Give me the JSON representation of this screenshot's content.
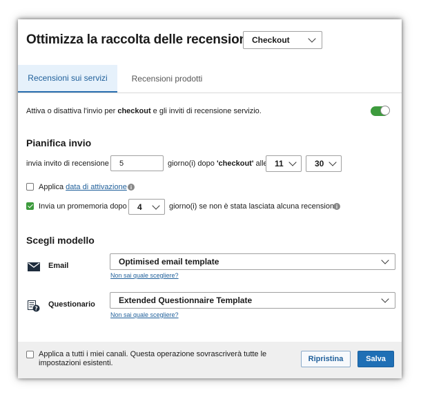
{
  "header": {
    "title": "Ottimizza la raccolta delle recensioni per",
    "channel_select": "Checkout"
  },
  "tabs": [
    {
      "label": "Recensioni sui servizi",
      "active": true
    },
    {
      "label": "Recensioni prodotti",
      "active": false
    }
  ],
  "toggle_row": {
    "pre": "Attiva o disattiva l'invio per ",
    "bold": "checkout",
    "post": " e gli inviti di recensione servizio.",
    "enabled": true
  },
  "schedule": {
    "title": "Pianifica invio",
    "send_label": "invia invito di recensione",
    "days_value": "5",
    "after_pre": "giorno(i) dopo ",
    "after_bold": "'checkout'",
    "after_post": " alle",
    "hour": "11",
    "minute": "30",
    "apply_label_pre": "Applica ",
    "apply_link": "data di attivazione",
    "apply_checked": false,
    "reminder_label": "Invia un promemoria dopo",
    "reminder_checked": true,
    "reminder_days": "4",
    "reminder_suffix": "giorno(i) se non è stata lasciata alcuna recensione"
  },
  "templates": {
    "title": "Scegli modello",
    "email": {
      "label": "Email",
      "value": "Optimised email template",
      "help": "Non sai quale scegliere?"
    },
    "questionnaire": {
      "label": "Questionario",
      "value": "Extended Questionnaire Template",
      "help": "Non sai quale scegliere?"
    }
  },
  "footer": {
    "apply_all_line1": "Applica a tutti i miei canali. Questa operazione sovrascriverà tutte le",
    "apply_all_line2": "impostazioni esistenti.",
    "apply_all_checked": false,
    "reset_label": "Ripristina",
    "save_label": "Salva"
  },
  "colors": {
    "accent": "#1f6fb5",
    "toggle_on": "#3d9b3d",
    "tab_active_bg": "#e6f1fb"
  },
  "icons": {
    "email": "envelope-icon",
    "questionnaire": "questionnaire-icon",
    "info": "info-icon"
  }
}
